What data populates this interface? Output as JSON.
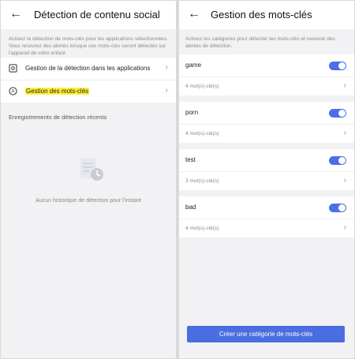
{
  "left": {
    "title": "Détection de contenu social",
    "description": "Activez la détection de mots-clés pour les applications sélectionnées. Vous recevrez des alertes lorsque ces mots-clés seront détectés sur l'appareil de votre enfant",
    "menu": [
      {
        "label": "Gestion de la détection dans les applications",
        "icon": "settings-square-icon"
      },
      {
        "label": "Gestion des mots-clés",
        "icon": "letter-a-circle-icon",
        "highlight_color": "#ffef3a"
      }
    ],
    "recent_title": "Enregistrements de détection récents",
    "empty_text": "Aucun historique de détection pour l'instant"
  },
  "right": {
    "title": "Gestion des mots-clés",
    "description": "Activez les catégories pour détecter les mots-clés et recevoir des alertes de détection.",
    "categories": [
      {
        "name": "game",
        "count": "4 mot(s)-clé(s)",
        "enabled": true
      },
      {
        "name": "porn",
        "count": "4 mot(s)-clé(s)",
        "enabled": true
      },
      {
        "name": "test",
        "count": "3 mot(s)-clé(s)",
        "enabled": true
      },
      {
        "name": "bad",
        "count": "4 mot(s)-clé(s)",
        "enabled": true
      }
    ],
    "create_button": "Créer une catégorie de mots-clés"
  },
  "colors": {
    "accent": "#4b6fe8",
    "highlight": "#ffef3a"
  }
}
